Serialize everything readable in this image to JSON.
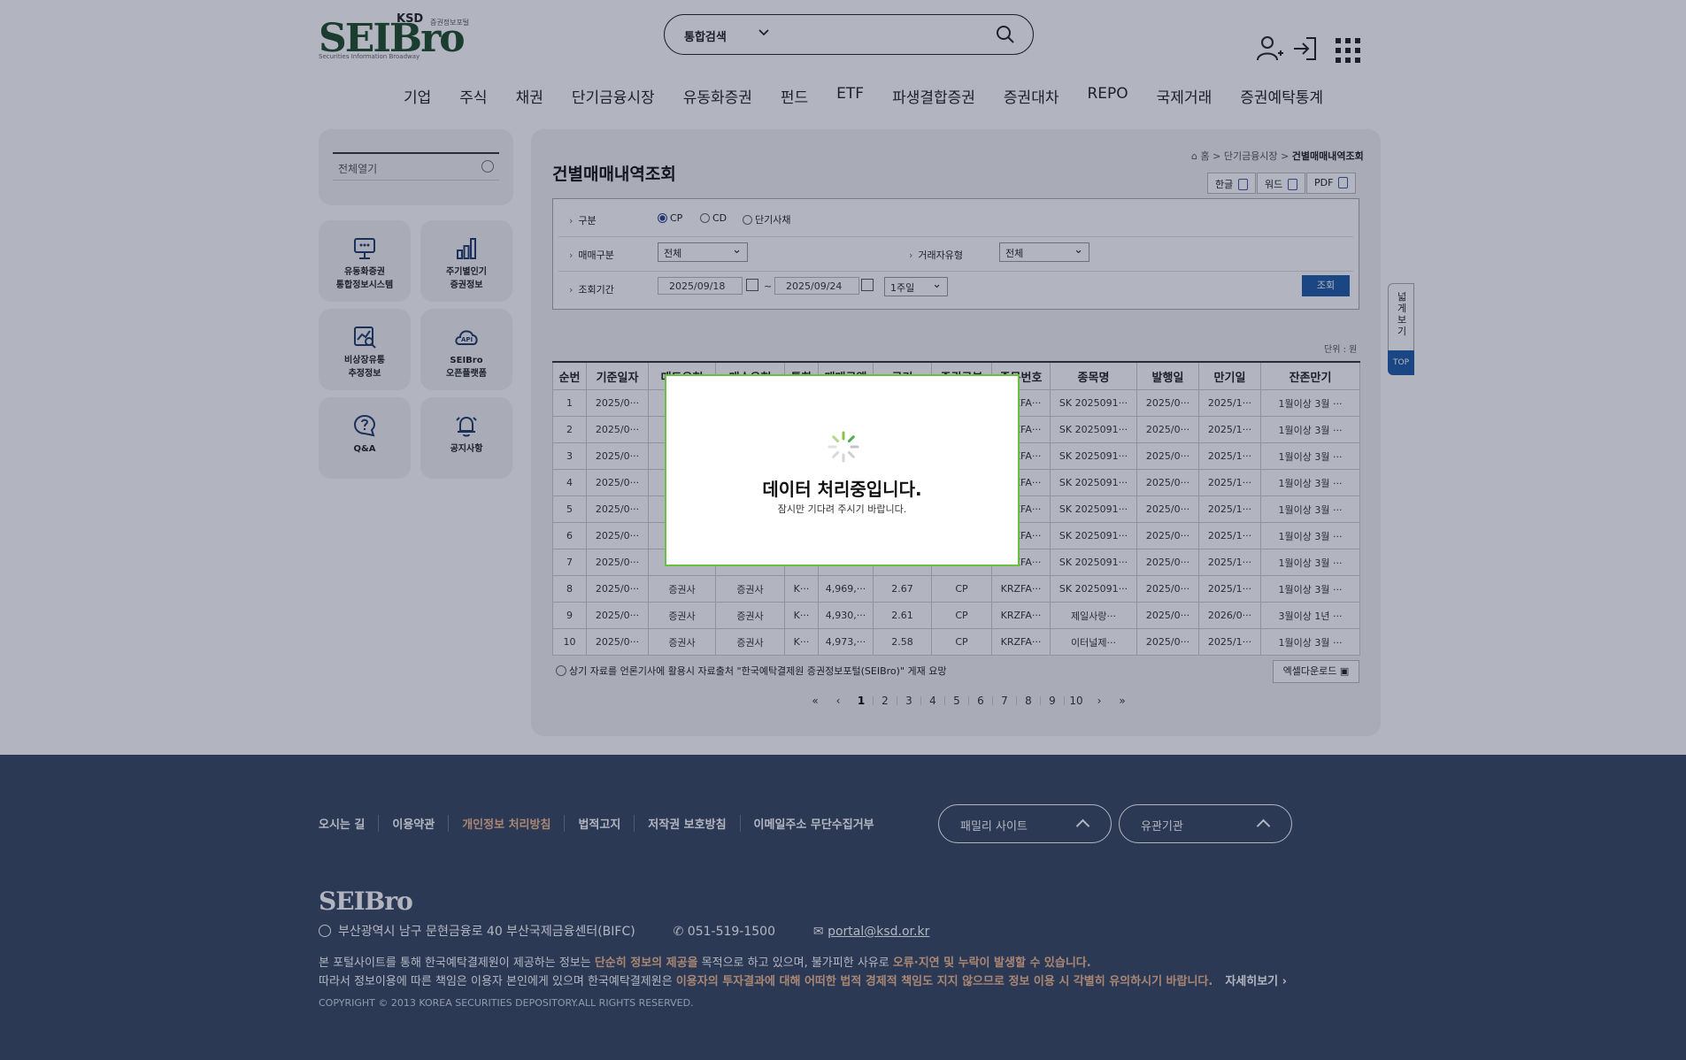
{
  "header": {
    "logo_text": "SEIBro",
    "logo_ksd": "KSD",
    "logo_tag": "증권정보포털",
    "logo_sub": "Securities Information Broadway",
    "search_scope": "통합검색",
    "icons": [
      "user-add-icon",
      "login-icon",
      "all-menu-icon"
    ]
  },
  "gnb": [
    "기업",
    "주식",
    "채권",
    "단기금융시장",
    "유동화증권",
    "펀드",
    "ETF",
    "파생결합증권",
    "증권대차",
    "REPO",
    "국제거래",
    "증권예탁통계"
  ],
  "sidebar": {
    "open_all": "전체열기",
    "tiles": [
      {
        "label": "유동화증권\n통합정보시스템",
        "icon": "presentation-icon"
      },
      {
        "label": "주기별인기\n증권정보",
        "icon": "bar-chart-icon"
      },
      {
        "label": "비상장유통\n추정정보",
        "icon": "chart-search-icon"
      },
      {
        "label": "SEIBro\n오픈플랫폼",
        "icon": "api-cloud-icon"
      },
      {
        "label": "Q&A",
        "icon": "question-bubble-icon"
      },
      {
        "label": "공지사항",
        "icon": "bell-icon"
      }
    ]
  },
  "page": {
    "title": "건별매매내역조회",
    "breadcrumb": {
      "home": "홈",
      "sep": ">",
      "section": "단기금융시장",
      "current": "건별매매내역조회"
    },
    "downloads": [
      "한글",
      "워드",
      "PDF"
    ]
  },
  "form": {
    "type_label": "구분",
    "type_options": [
      "CP",
      "CD",
      "단기사채"
    ],
    "type_selected": "CP",
    "trade_label": "매매구분",
    "trade_value": "전체",
    "reason_label": "거래자유형",
    "reason_value": "전체",
    "period_label": "조회기간",
    "date_from": "2025/09/18",
    "date_sep": "~",
    "date_to": "2025/09/24",
    "period_value": "1주일",
    "search_button": "조회"
  },
  "table": {
    "unit": "단위 : 원",
    "columns": [
      "순번",
      "기준일자",
      "매도유형",
      "매수유형",
      "통화",
      "매매금액",
      "금리",
      "증권구분",
      "종목번호",
      "종목명",
      "발행일",
      "만기일",
      "잔존만기"
    ],
    "rows": [
      [
        "1",
        "2025/0···",
        "",
        "",
        "",
        "",
        "",
        "",
        "KRZFA···",
        "SK 2025091···",
        "2025/0···",
        "2025/1···",
        "1월이상 3월 ···"
      ],
      [
        "2",
        "2025/0···",
        "",
        "",
        "",
        "",
        "",
        "",
        "KRZFA···",
        "SK 2025091···",
        "2025/0···",
        "2025/1···",
        "1월이상 3월 ···"
      ],
      [
        "3",
        "2025/0···",
        "",
        "",
        "",
        "",
        "",
        "",
        "KRZFA···",
        "SK 2025091···",
        "2025/0···",
        "2025/1···",
        "1월이상 3월 ···"
      ],
      [
        "4",
        "2025/0···",
        "",
        "",
        "",
        "",
        "",
        "",
        "KRZFA···",
        "SK 2025091···",
        "2025/0···",
        "2025/1···",
        "1월이상 3월 ···"
      ],
      [
        "5",
        "2025/0···",
        "",
        "",
        "",
        "",
        "",
        "",
        "KRZFA···",
        "SK 2025091···",
        "2025/0···",
        "2025/1···",
        "1월이상 3월 ···"
      ],
      [
        "6",
        "2025/0···",
        "",
        "",
        "",
        "",
        "",
        "",
        "KRZFA···",
        "SK 2025091···",
        "2025/0···",
        "2025/1···",
        "1월이상 3월 ···"
      ],
      [
        "7",
        "2025/0···",
        "",
        "",
        "",
        "",
        "",
        "",
        "KRZFA···",
        "SK 2025091···",
        "2025/0···",
        "2025/1···",
        "1월이상 3월 ···"
      ],
      [
        "8",
        "2025/0···",
        "증권사",
        "증권사",
        "K···",
        "4,969,···",
        "2.67",
        "CP",
        "KRZFA···",
        "SK 2025091···",
        "2025/0···",
        "2025/1···",
        "1월이상 3월 ···"
      ],
      [
        "9",
        "2025/0···",
        "증권사",
        "증권사",
        "K···",
        "4,930,···",
        "2.61",
        "CP",
        "KRZFA···",
        "제일사랑···",
        "2025/0···",
        "2026/0···",
        "3월이상 1년 ···"
      ],
      [
        "10",
        "2025/0···",
        "증권사",
        "증권사",
        "K···",
        "4,973,···",
        "2.58",
        "CP",
        "KRZFA···",
        "이터널제···",
        "2025/0···",
        "2025/1···",
        "1월이상 3월 ···"
      ]
    ],
    "note": "상기 자료를 언론기사에 활용시 자료출처 \"한국예탁결제원 증권정보포털(SEIBro)\" 게재 요망",
    "excel_button": "엑셀다운로드"
  },
  "pager": {
    "pages": [
      "1",
      "2",
      "3",
      "4",
      "5",
      "6",
      "7",
      "8",
      "9",
      "10"
    ],
    "current": "1"
  },
  "side_tab": {
    "wide_view": "넓게보기",
    "top": "TOP"
  },
  "modal": {
    "title": "데이터 처리중입니다.",
    "subtitle": "잠시만 기다려 주시기 바랍니다."
  },
  "footer": {
    "links": [
      "오시는 길",
      "이용약관",
      "개인정보 처리방침",
      "법적고지",
      "저작권 보호방침",
      "이메일주소 무단수집거부"
    ],
    "family_site": "패밀리 사이트",
    "related": "유관기관",
    "logo": "SEIBro",
    "address": "부산광역시 남구 문현금융로 40 부산국제금융센터(BIFC)",
    "phone": "051-519-1500",
    "email": "portal@ksd.or.kr",
    "disc1_a": "본 포털사이트를 통해 한국예탁결제원이 제공하는 정보는 ",
    "disc1_b": "단순히 정보의 제공을",
    "disc1_c": " 목적으로 하고 있으며, 불가피한 사유로 ",
    "disc1_d": "오류·지연 및 누락이 발생할 수 있습니다.",
    "disc2_a": "따라서 정보이용에 따른 책임은 이용자 본인에게 있으며 한국예탁결제원은 ",
    "disc2_b": "이용자의 투자결과에 대해 어떠한 법적 경제적 책임도 지지 않으므로 정보 이용 시 각별히 유의하시기 바랍니다.",
    "more": "자세히보기",
    "copyright": "COPYRIGHT © 2013 KOREA SECURITIES DEPOSITORY.ALL RIGHTS RESERVED."
  },
  "colors": {
    "brand_green": "#3aa33d",
    "primary_blue": "#1f5aa8",
    "footer_bg": "#384762",
    "accent_orange": "#f2b98e",
    "modal_border": "#6bbf3e"
  }
}
